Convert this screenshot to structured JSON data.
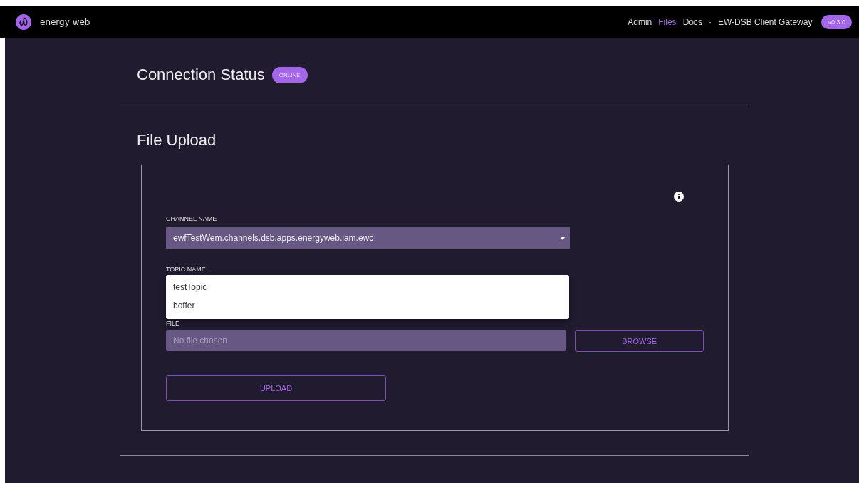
{
  "brand": {
    "name": "energy web"
  },
  "nav": {
    "links": [
      {
        "label": "Admin",
        "selected": false
      },
      {
        "label": "Files",
        "selected": true
      },
      {
        "label": "Docs",
        "selected": false
      }
    ],
    "separator": "·",
    "app_name": "EW-DSB Client Gateway",
    "version": "v0.3.0"
  },
  "connection": {
    "title": "Connection Status",
    "status": "ONLINE"
  },
  "upload": {
    "title": "File Upload",
    "channel": {
      "label": "CHANNEL NAME",
      "value": "ewfTestWem.channels.dsb.apps.energyweb.iam.ewc"
    },
    "topic": {
      "label": "TOPIC NAME",
      "options": [
        "testTopic",
        "boffer"
      ]
    },
    "file": {
      "label": "FILE",
      "placeholder": "No file chosen",
      "browse": "BROWSE"
    },
    "submit": "UPLOAD"
  }
}
